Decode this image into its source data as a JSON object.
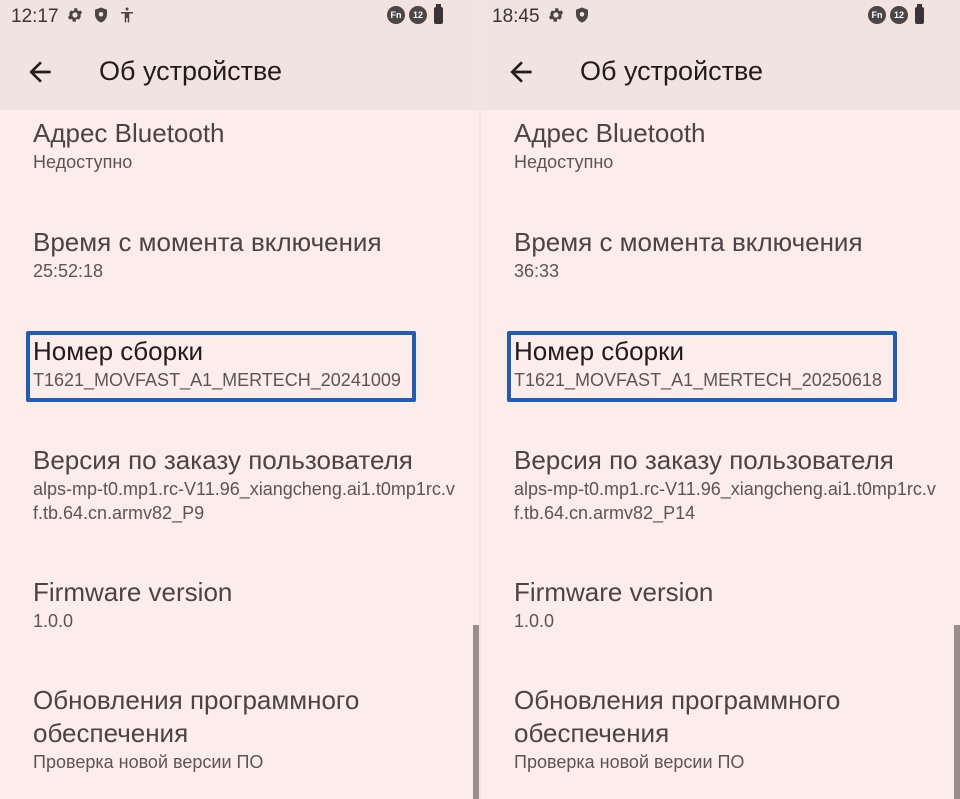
{
  "screens": [
    {
      "status": {
        "time": "12:17",
        "fn_badge": "Fn",
        "num_badge": "12"
      },
      "title": "Об устройстве",
      "items": [
        {
          "title": "Адрес Bluetooth",
          "value": "Недоступно"
        },
        {
          "title": "Время с момента включения",
          "value": "25:52:18"
        },
        {
          "title": "Номер сборки",
          "value": "T1621_MOVFAST_A1_MERTECH_20241009"
        },
        {
          "title": "Версия по заказу пользователя",
          "value": "alps-mp-t0.mp1.rc-V11.96_xiangcheng.ai1.t0mp1rc.vf.tb.64.cn.armv82_P9"
        },
        {
          "title": "Firmware version",
          "value": "1.0.0"
        },
        {
          "title": "Обновления программного обеспечения",
          "value": "Проверка новой версии ПО"
        }
      ]
    },
    {
      "status": {
        "time": "18:45",
        "fn_badge": "Fn",
        "num_badge": "12"
      },
      "title": "Об устройстве",
      "items": [
        {
          "title": "Адрес Bluetooth",
          "value": "Недоступно"
        },
        {
          "title": "Время с момента включения",
          "value": "36:33"
        },
        {
          "title": "Номер сборки",
          "value": "T1621_MOVFAST_A1_MERTECH_20250618"
        },
        {
          "title": "Версия по заказу пользователя",
          "value": "alps-mp-t0.mp1.rc-V11.96_xiangcheng.ai1.t0mp1rc.vf.tb.64.cn.armv82_P14"
        },
        {
          "title": "Firmware version",
          "value": "1.0.0"
        },
        {
          "title": "Обновления программного обеспечения",
          "value": "Проверка новой версии ПО"
        }
      ]
    }
  ],
  "colors": {
    "background": "#fcedea",
    "appbar": "#f1e3df",
    "highlight_border": "#1f5cb8"
  }
}
